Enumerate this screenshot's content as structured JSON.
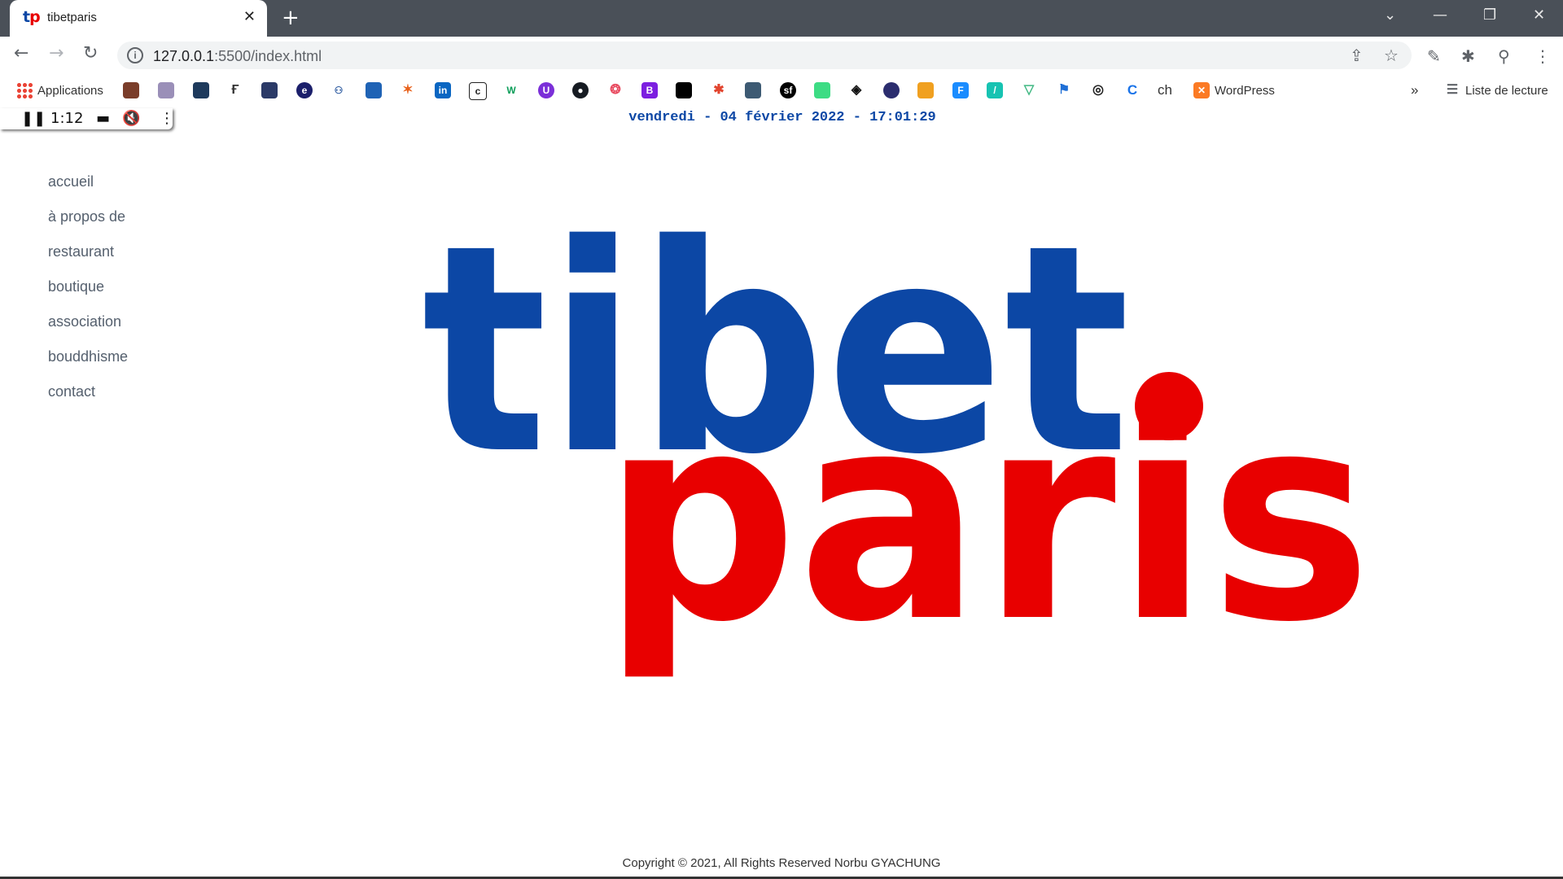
{
  "browser": {
    "tab_title": "tibetparis",
    "favicon_text_t": "t",
    "favicon_text_p": "p",
    "url_host": "127.0.0.1",
    "url_path": ":5500/index.html",
    "reading_list_label": "Liste de lecture",
    "bookmarks": {
      "apps_label": "Applications",
      "wordpress_label": "WordPress",
      "ch_label": "ch",
      "more_label": "»"
    },
    "colors": {
      "titlebar": "#4a5058",
      "accent_blue": "#0c47a5",
      "accent_red": "#e80000"
    }
  },
  "media": {
    "time": "1:12"
  },
  "page": {
    "datetime": "vendredi - 04 février 2022 - 17:01:29",
    "nav": [
      "accueil",
      "à propos de",
      "restaurant",
      "boutique",
      "association",
      "bouddhisme",
      "contact"
    ],
    "logo": {
      "line1": "tibet",
      "line2": "paris"
    },
    "footer": "Copyright © 2021, All Rights Reserved Norbu GYACHUNG"
  }
}
